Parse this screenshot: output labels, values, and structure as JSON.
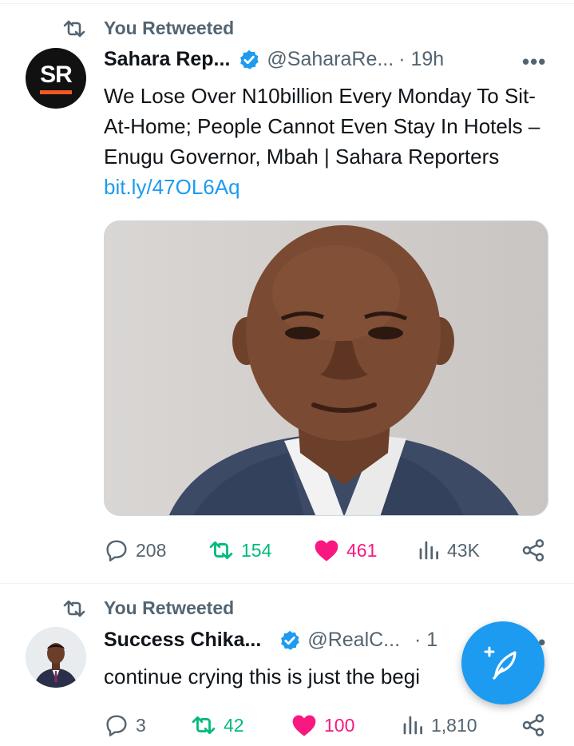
{
  "tweets": [
    {
      "retweet_label": "You Retweeted",
      "author_name": "Sahara Rep...",
      "author_handle": "@SaharaRe...",
      "time": "· 19h",
      "avatar_text": "SR",
      "text": "We Lose Over N10billion Every Monday To Sit-At-Home; People Cannot Even Stay In Hotels – Enugu Governor, Mbah  | Sahara Reporters ",
      "link": "bit.ly/47OL6Aq",
      "replies": "208",
      "retweets": "154",
      "likes": "461",
      "views": "43K"
    },
    {
      "retweet_label": "You Retweeted",
      "author_name": "Success Chika...",
      "author_handle": "@RealC...",
      "time": "· 1",
      "text": "continue crying this is just the begi",
      "replies": "3",
      "retweets": "42",
      "likes": "100",
      "views": "1,810"
    }
  ],
  "more_label": "•••",
  "colors": {
    "accent": "#1d9bf0",
    "retweet_green": "#00ba7c",
    "like_pink": "#f91880",
    "secondary_text": "#536471",
    "brand_orange": "#f05a22"
  },
  "icons": {
    "retweet": "retweet-icon",
    "verified": "verified-badge-icon",
    "reply": "reply-icon",
    "like": "heart-icon",
    "views": "views-icon",
    "share": "share-icon",
    "compose": "compose-feather-icon"
  }
}
